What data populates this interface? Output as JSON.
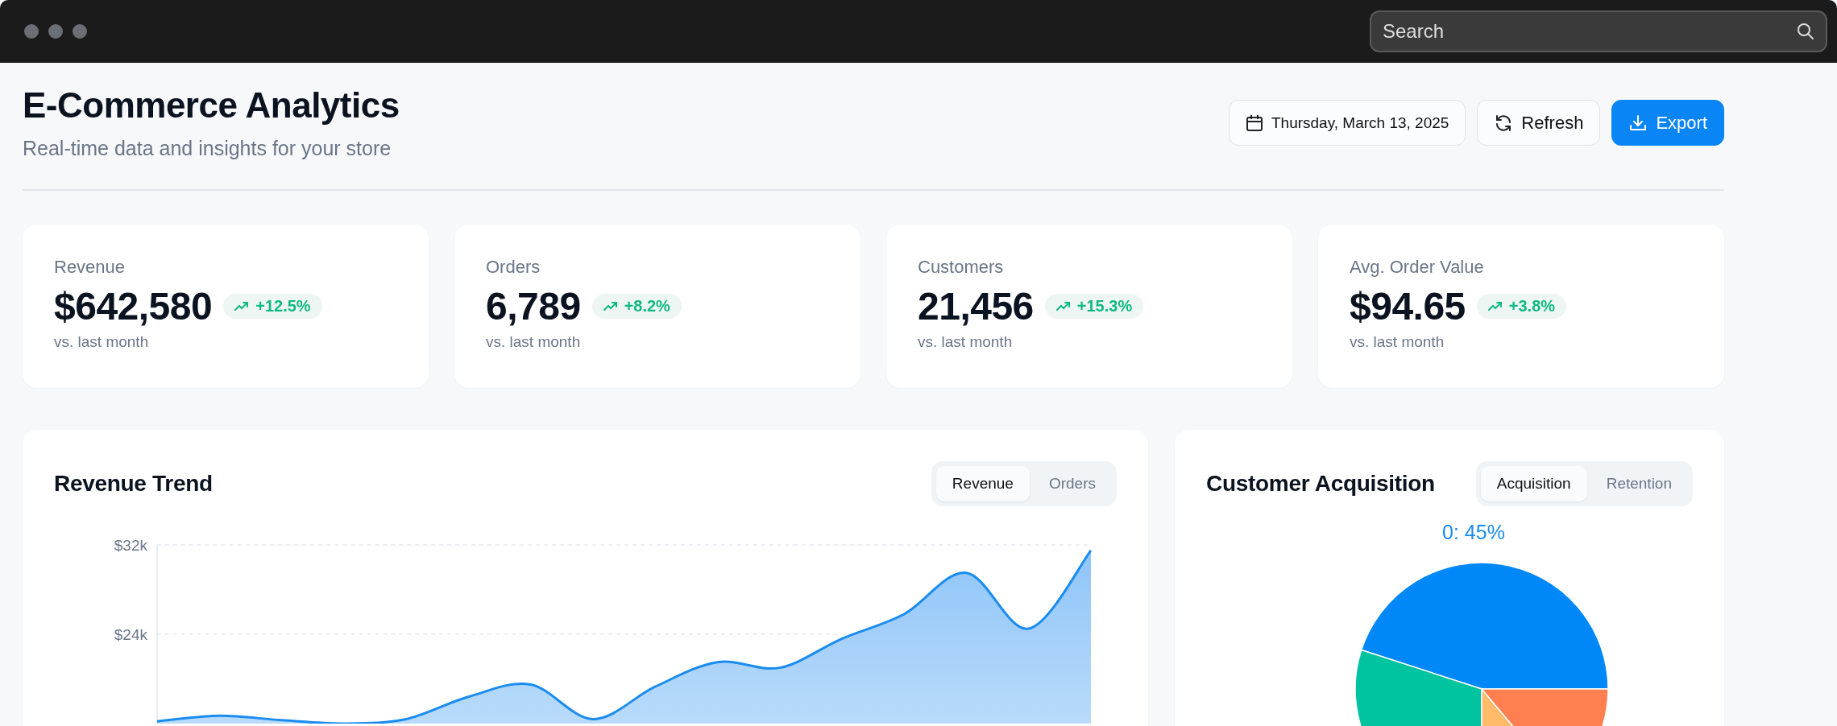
{
  "search": {
    "placeholder": "Search"
  },
  "header": {
    "title": "E-Commerce Analytics",
    "subtitle": "Real-time data and insights for your store",
    "date": "Thursday, March 13, 2025",
    "buttons": [
      {
        "label": "Refresh",
        "kind": "refresh"
      },
      {
        "label": "Export",
        "kind": "export"
      }
    ]
  },
  "stats": [
    {
      "label": "Revenue",
      "value": "$642,580",
      "change": "+12.5%",
      "note": "vs. last month"
    },
    {
      "label": "Orders",
      "value": "6,789",
      "change": "+8.2%",
      "note": "vs. last month"
    },
    {
      "label": "Customers",
      "value": "21,456",
      "change": "+15.3%",
      "note": "vs. last month"
    },
    {
      "label": "Avg. Order Value",
      "value": "$94.65",
      "change": "+3.8%",
      "note": "vs. last month"
    }
  ],
  "revenue_chart": {
    "title": "Revenue Trend",
    "tabs": [
      {
        "label": "Revenue",
        "selected": true
      },
      {
        "label": "Orders",
        "selected": false
      }
    ],
    "chart_data": {
      "type": "area",
      "ylim": [
        16000,
        32000
      ],
      "yticks": [
        {
          "value": 24000,
          "label": "$24k"
        },
        {
          "value": 32000,
          "label": "$32k"
        }
      ],
      "series": [
        {
          "color": "#1a8cf0",
          "values": [
            16200,
            16700,
            16300,
            16000,
            16400,
            18400,
            19500,
            16400,
            19300,
            21500,
            21000,
            23600,
            25800,
            29500,
            24500,
            31500
          ]
        }
      ]
    }
  },
  "acquisition_chart": {
    "title": "Customer Acquisition",
    "tabs": [
      {
        "label": "Acquisition",
        "selected": true
      },
      {
        "label": "Retention",
        "selected": false
      }
    ],
    "label": "0: 45%"
  }
}
